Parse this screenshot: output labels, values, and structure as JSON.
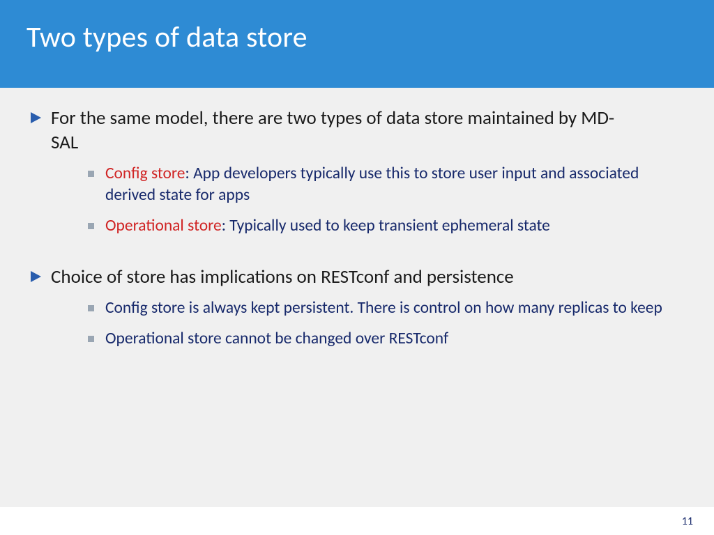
{
  "slide": {
    "title": "Two types of data store",
    "page_number": "11",
    "bullets": [
      {
        "text": "For the same model, there are two types of data store maintained by MD-SAL",
        "sub": [
          {
            "label": "Config store",
            "rest": ": App developers typically use this to store user input and associated derived state for apps"
          },
          {
            "label": "Operational store",
            "rest": ": Typically used to keep transient ephemeral state"
          }
        ]
      },
      {
        "text": "Choice of store has implications on RESTconf and persistence",
        "sub": [
          {
            "label": "",
            "rest": "Config store is always kept persistent. There is control on how many replicas to keep"
          },
          {
            "label": "",
            "rest": "Operational store cannot be changed over RESTconf"
          }
        ]
      }
    ]
  }
}
